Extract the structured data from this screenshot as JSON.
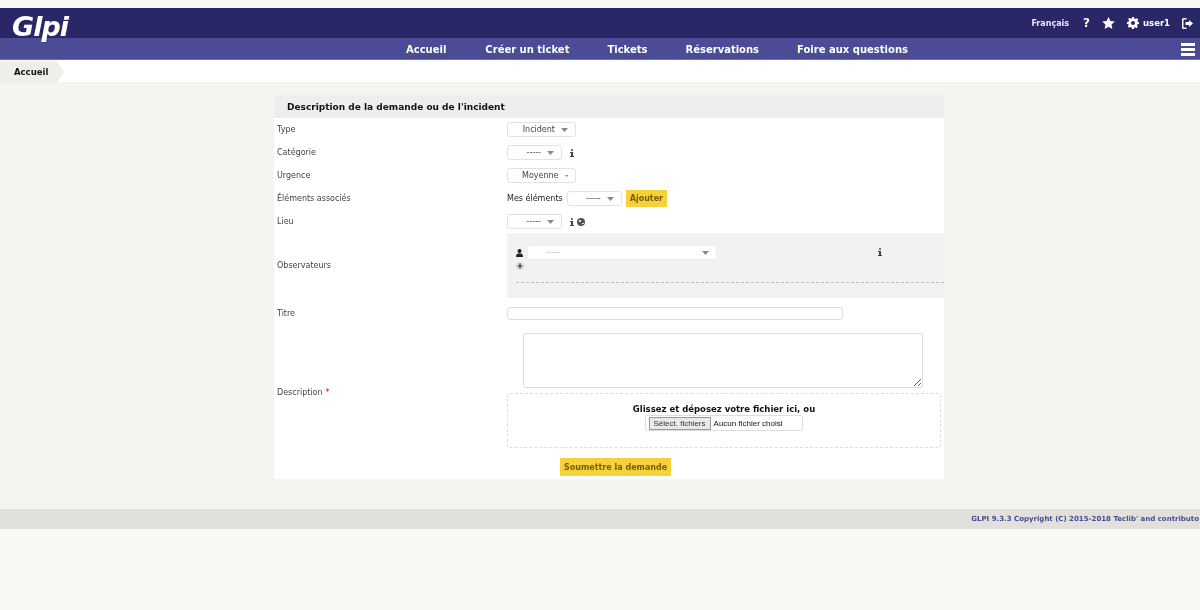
{
  "header": {
    "logo": "Glpi",
    "language": "Français",
    "help": "?",
    "user": "user1"
  },
  "nav": [
    "Accueil",
    "Créer un ticket",
    "Tickets",
    "Réservations",
    "Foire aux questions"
  ],
  "breadcrumb": "Accueil",
  "form": {
    "title": "Description de la demande ou de l'incident",
    "fields": [
      {
        "kind": "select",
        "label": "Type",
        "value": "Incident"
      },
      {
        "kind": "select",
        "label": "Catégorie",
        "value": "-----",
        "info": true
      },
      {
        "kind": "select",
        "label": "Urgence",
        "value": "Moyenne"
      },
      {
        "kind": "items",
        "label": "Éléments associés",
        "prefix": "Mes éléments",
        "value": "-----",
        "button": "Ajouter"
      },
      {
        "kind": "select",
        "label": "Lieu",
        "value": "-----",
        "info": true,
        "globe": true
      },
      {
        "kind": "observers",
        "label": "Observateurs",
        "placeholder": "-----"
      },
      {
        "kind": "text",
        "label": "Titre"
      },
      {
        "kind": "description",
        "label": "Description",
        "required_mark": "*",
        "drop_text": "Glissez et déposez votre fichier ici, ou",
        "file_button": "Sélect. fichiers",
        "file_status": "Aucun fichier choisi"
      }
    ],
    "submit": "Soumettre la demande"
  },
  "footer": "GLPI 9.3.3 Copyright (C) 2015-2018 Teclib' and contributo"
}
